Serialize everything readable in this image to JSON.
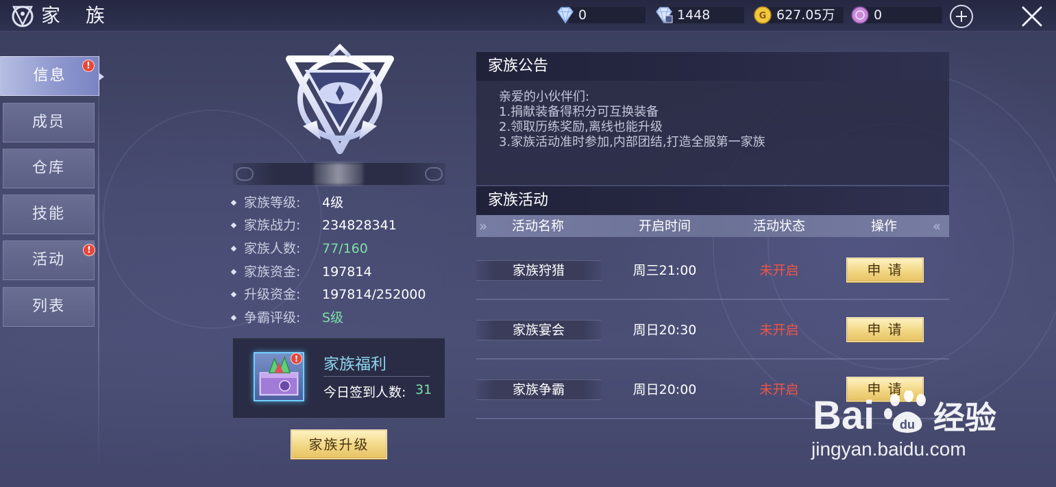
{
  "header": {
    "title": "家 族",
    "currencies": [
      {
        "icon": "diamond-icon",
        "value": "0"
      },
      {
        "icon": "bound-diamond-icon",
        "value": "1448"
      },
      {
        "icon": "gold-coin-icon",
        "value": "627.05万"
      },
      {
        "icon": "contribution-icon",
        "value": "0"
      }
    ]
  },
  "sidebar": {
    "items": [
      {
        "label": "信息",
        "active": true,
        "badge": "!"
      },
      {
        "label": "成员"
      },
      {
        "label": "仓库"
      },
      {
        "label": "技能"
      },
      {
        "label": "活动",
        "badge": "!"
      },
      {
        "label": "列表"
      }
    ]
  },
  "family": {
    "stats": [
      {
        "label": "家族等级:",
        "value": "4级"
      },
      {
        "label": "家族战力:",
        "value": "234828341"
      },
      {
        "label": "家族人数:",
        "value": "77/160"
      },
      {
        "label": "家族资金:",
        "value": "197814"
      },
      {
        "label": "升级资金:",
        "value": "197814/252000"
      },
      {
        "label": "争霸评级:",
        "value": "S级"
      }
    ],
    "welfare": {
      "title": "家族福利",
      "signin_label": "今日签到人数:",
      "signin_count": "31",
      "badge": "!"
    },
    "upgrade_button": "家族升级"
  },
  "notice": {
    "title": "家族公告",
    "lines": [
      "亲爱的小伙伴们:",
      "1.捐献装备得积分可互换装备",
      "2.领取历练奖励,离线也能升级",
      "3.家族活动准时参加,内部团结,打造全服第一家族"
    ]
  },
  "activities": {
    "title": "家族活动",
    "columns": [
      "活动名称",
      "开启时间",
      "活动状态",
      "操作"
    ],
    "rows": [
      {
        "name": "家族狩猎",
        "time": "周三21:00",
        "status": "未开启",
        "action": "申 请"
      },
      {
        "name": "家族宴会",
        "time": "周日20:30",
        "status": "未开启",
        "action": "申 请"
      },
      {
        "name": "家族争霸",
        "time": "周日20:00",
        "status": "未开启",
        "action": "申 请"
      }
    ]
  },
  "watermark": {
    "logo_text": "Bai 经验",
    "url": "jingyan.baidu.com"
  },
  "colors": {
    "status_closed": "#f05448",
    "highlight_green": "#7fe0a8",
    "welfare_title": "#8fd4f0",
    "button_gold": "#f2d785"
  }
}
